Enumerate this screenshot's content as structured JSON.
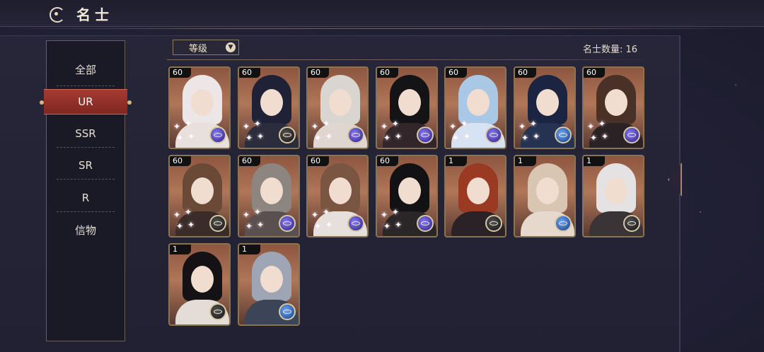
{
  "title": "名士",
  "sidebar": {
    "items": [
      {
        "label": "全部",
        "active": false
      },
      {
        "label": "UR",
        "active": true
      },
      {
        "label": "SSR",
        "active": false
      },
      {
        "label": "SR",
        "active": false
      },
      {
        "label": "R",
        "active": false
      },
      {
        "label": "信物",
        "active": false
      }
    ]
  },
  "toolbar": {
    "sort_label": "等级",
    "count_text": "名士数量: 16"
  },
  "cards": [
    {
      "level": "60",
      "hair": "#ece7e6",
      "robe": "#e8e0dc",
      "badge": "orb-purple",
      "stars": 4
    },
    {
      "level": "60",
      "hair": "#1f2237",
      "robe": "#2b2d3c",
      "badge": "orb-dark",
      "stars": 4
    },
    {
      "level": "60",
      "hair": "#d9d5d1",
      "robe": "#e0d6d0",
      "badge": "orb-purple",
      "stars": 4
    },
    {
      "level": "60",
      "hair": "#141315",
      "robe": "#33262a",
      "badge": "orb-purple",
      "stars": 4
    },
    {
      "level": "60",
      "hair": "#a9c8e6",
      "robe": "#d7e3f2",
      "badge": "orb-purple",
      "stars": 4
    },
    {
      "level": "60",
      "hair": "#1b2440",
      "robe": "#253252",
      "badge": "orb-blue",
      "stars": 4
    },
    {
      "level": "60",
      "hair": "#4a3128",
      "robe": "#2a2224",
      "badge": "orb-purple",
      "stars": 4
    },
    {
      "level": "60",
      "hair": "#6a4a36",
      "robe": "#3a2c28",
      "badge": "orb-dark",
      "stars": 4
    },
    {
      "level": "60",
      "hair": "#8d8580",
      "robe": "#5a5050",
      "badge": "orb-purple",
      "stars": 4
    },
    {
      "level": "60",
      "hair": "#7a5542",
      "robe": "#e6e0dc",
      "badge": "orb-purple",
      "stars": 4
    },
    {
      "level": "60",
      "hair": "#121114",
      "robe": "#2a2628",
      "badge": "orb-purple",
      "stars": 4
    },
    {
      "level": "1",
      "hair": "#9a3a22",
      "robe": "#2a2226",
      "badge": "orb-dark",
      "stars": 0
    },
    {
      "level": "1",
      "hair": "#d8c5b2",
      "robe": "#e6d8cc",
      "badge": "orb-blue",
      "stars": 0
    },
    {
      "level": "1",
      "hair": "#e4e2e2",
      "robe": "#3a3436",
      "badge": "orb-dark",
      "stars": 0
    },
    {
      "level": "1",
      "hair": "#141214",
      "robe": "#e4dcd6",
      "badge": "orb-dark",
      "stars": 0
    },
    {
      "level": "1",
      "hair": "#9ea6b6",
      "robe": "#3c4458",
      "badge": "orb-blue",
      "stars": 0
    }
  ]
}
